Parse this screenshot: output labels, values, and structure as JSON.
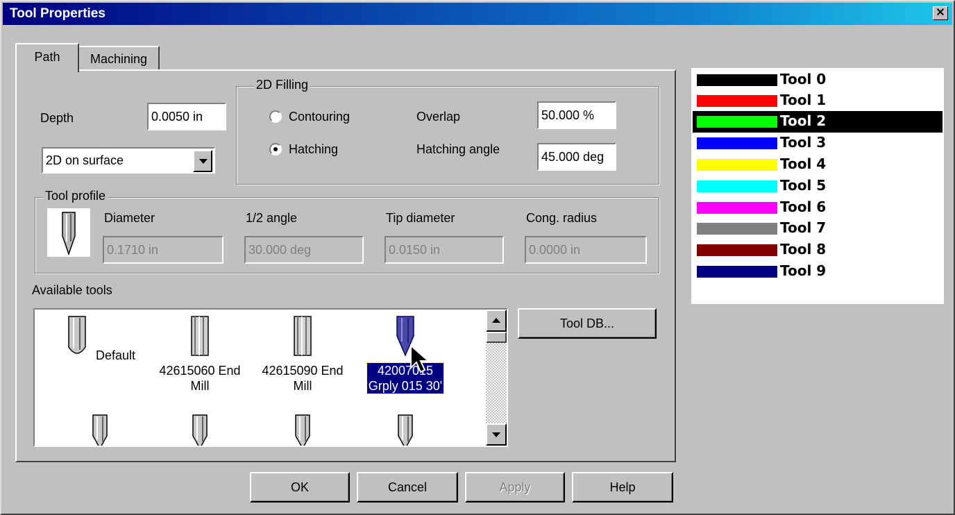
{
  "window": {
    "title": "Tool Properties",
    "close_glyph": "✕"
  },
  "tabs": [
    {
      "label": "Path"
    },
    {
      "label": "Machining"
    }
  ],
  "depth": {
    "label": "Depth",
    "value": "0.0050 in"
  },
  "mode_select": {
    "value": "2D on surface"
  },
  "filling": {
    "group_label": "2D Filling",
    "contouring_label": "Contouring",
    "hatching_label": "Hatching",
    "selected": "Hatching",
    "overlap_label": "Overlap",
    "overlap_value": "50.000 %",
    "angle_label": "Hatching angle",
    "angle_value": "45.000 deg"
  },
  "profile": {
    "group_label": "Tool profile",
    "diameter_label": "Diameter",
    "diameter_value": "0.1710 in",
    "half_angle_label": "1/2 angle",
    "half_angle_value": "30.000 deg",
    "tip_label": "Tip diameter",
    "tip_value": "0.0150 in",
    "cong_label": "Cong. radius",
    "cong_value": "0.0000 in"
  },
  "available": {
    "label": "Available tools",
    "items": [
      {
        "line1": "Default",
        "line2": ""
      },
      {
        "line1": "42615060 End",
        "line2": "Mill"
      },
      {
        "line1": "42615090 End",
        "line2": "Mill"
      },
      {
        "line1": "42007015",
        "line2": "Grply 015 30'",
        "selected": true
      }
    ]
  },
  "buttons": {
    "tool_db": "Tool DB...",
    "ok": "OK",
    "cancel": "Cancel",
    "apply": "Apply",
    "help": "Help"
  },
  "tool_colors": [
    {
      "name": "Tool 0",
      "color": "#000000"
    },
    {
      "name": "Tool 1",
      "color": "#ff0000"
    },
    {
      "name": "Tool 2",
      "color": "#00ff00",
      "selected": true
    },
    {
      "name": "Tool 3",
      "color": "#0000ff"
    },
    {
      "name": "Tool 4",
      "color": "#ffff00"
    },
    {
      "name": "Tool 5",
      "color": "#00ffff"
    },
    {
      "name": "Tool 6",
      "color": "#ff00ff"
    },
    {
      "name": "Tool 7",
      "color": "#808080"
    },
    {
      "name": "Tool 8",
      "color": "#800000"
    },
    {
      "name": "Tool 9",
      "color": "#000080"
    }
  ]
}
